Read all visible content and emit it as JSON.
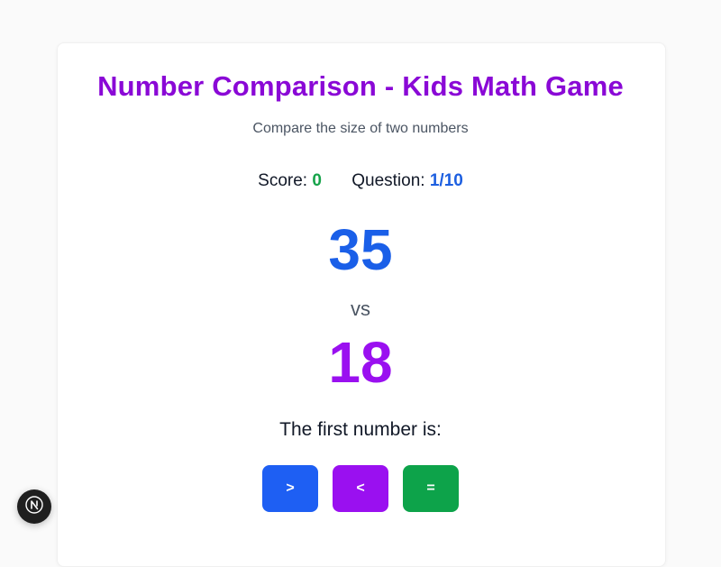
{
  "game": {
    "title": "Number Comparison - Kids Math Game",
    "subtitle": "Compare the size of two numbers",
    "score_label": "Score:",
    "score_value": "0",
    "question_label": "Question:",
    "question_value": "1/10",
    "first_number": "35",
    "vs_label": "vs",
    "second_number": "18",
    "prompt": "The first number is:"
  },
  "answers": {
    "greater": ">",
    "less": "<",
    "equal": "="
  },
  "colors": {
    "title": "#8a08d6",
    "first_number": "#1a5fe8",
    "second_number": "#9a10f0",
    "score": "#16a34a",
    "question": "#1d5fe0",
    "btn_greater": "#1e5ff3",
    "btn_less": "#9a10f0",
    "btn_equal": "#0da34a"
  },
  "dev_badge": {
    "icon": "nextjs-logo-icon"
  }
}
